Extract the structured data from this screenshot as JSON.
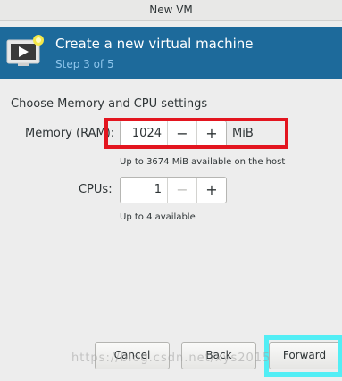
{
  "window": {
    "title": "New VM"
  },
  "banner": {
    "title": "Create a new virtual machine",
    "step": "Step 3 of 5"
  },
  "section": {
    "title": "Choose Memory and CPU settings"
  },
  "memory": {
    "label": "Memory (RAM):",
    "value": "1024",
    "unit": "MiB",
    "hint": "Up to 3674 MiB available on the host",
    "minus": "−",
    "plus": "+"
  },
  "cpus": {
    "label": "CPUs:",
    "value": "1",
    "hint": "Up to 4 available",
    "minus": "−",
    "plus": "+"
  },
  "buttons": {
    "cancel": "Cancel",
    "back": "Back",
    "forward": "Forward"
  },
  "watermark": "https://blog.csdn.net/xys2015",
  "colors": {
    "banner": "#1d6a9b",
    "step_text": "#8fc6ec",
    "annotation_red": "#e3151f",
    "annotation_cyan": "#52eef5"
  }
}
